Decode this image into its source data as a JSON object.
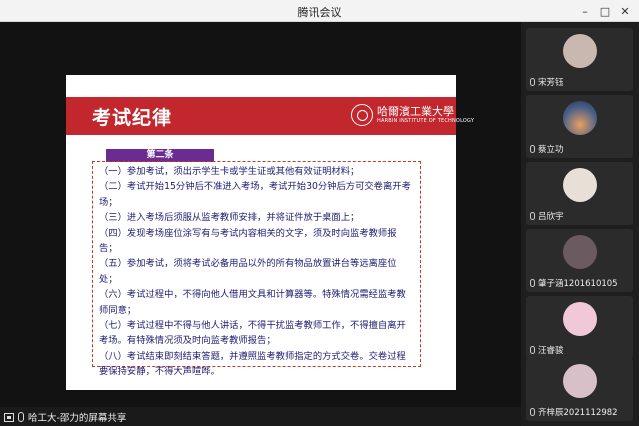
{
  "window": {
    "title": "腾讯会议",
    "controls": [
      "–",
      "□",
      "✕"
    ]
  },
  "slide": {
    "title": "考试纪律",
    "logo_cn": "哈爾濱工業大學",
    "logo_en": "HARBIN INSTITUTE OF TECHNOLOGY",
    "section_tag": "第二条",
    "rules": [
      "（一）参加考试，须出示学生卡或学生证或其他有效证明材料；",
      "（二）考试开始15分钟后不准进入考场，考试开始30分钟后方可交卷离开考场；",
      "（三）进入考场后须服从监考教师安排，并将证件放于桌面上；",
      "（四）发现考场座位涂写有与考试内容相关的文字，须及时向监考教师报告；",
      "（五）参加考试，须将考试必备用品以外的所有物品放置讲台等远离座位处；",
      "（六）考试过程中，不得向他人借用文具和计算器等。特殊情况需经监考教师同意；",
      "（七）考试过程中不得与他人讲话，不得干扰监考教师工作，不得擅自离开考场。有特殊情况须及时向监考教师报告；",
      "（八）考试结束即刻结束答题，并遵照监考教师指定的方式交卷。交卷过程要保持安静，不得大声喧哗。"
    ]
  },
  "share_label": "哈工大-邵力的屏幕共享",
  "participants": [
    {
      "name": "宋芳钰",
      "avatar_color": "#c8b8b0"
    },
    {
      "name": "蔡立功",
      "avatar_color": "#4a5f8a"
    },
    {
      "name": "吕欣宇",
      "avatar_color": "#e8e0d6"
    },
    {
      "name": "肇子涵1201610105",
      "avatar_color": "#6b5a60"
    },
    {
      "name": "汪睿骏",
      "avatar_color": "#f0c8d8"
    },
    {
      "name": "齐梓辰2021112982",
      "avatar_color": "#d8c0c8"
    }
  ]
}
